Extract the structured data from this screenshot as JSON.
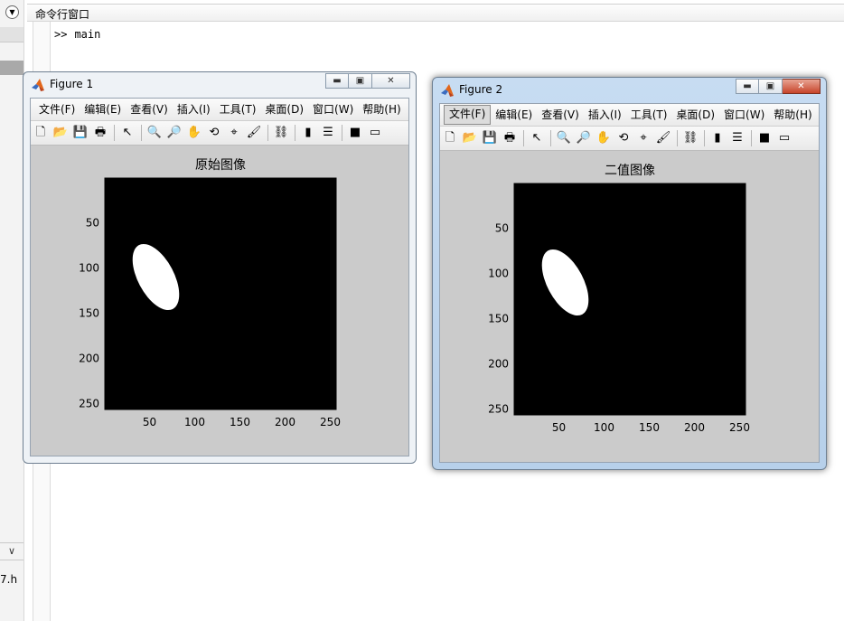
{
  "command_window": {
    "title": "命令行窗口",
    "prompt": ">>",
    "command": "main",
    "left_fragment": "7.h"
  },
  "figures": [
    {
      "title": "Figure 1",
      "menu": [
        "文件(F)",
        "编辑(E)",
        "查看(V)",
        "插入(I)",
        "工具(T)",
        "桌面(D)",
        "窗口(W)",
        "帮助(H)"
      ],
      "active_menu": -1,
      "plot_title": "原始图像",
      "ellipse": {
        "cx": 57,
        "cy": 110,
        "rx": 20,
        "ry": 40,
        "rotation_deg": -28
      }
    },
    {
      "title": "Figure 2",
      "menu": [
        "文件(F)",
        "编辑(E)",
        "查看(V)",
        "插入(I)",
        "工具(T)",
        "桌面(D)",
        "窗口(W)",
        "帮助(H)"
      ],
      "active_menu": 0,
      "plot_title": "二值图像",
      "ellipse": {
        "cx": 57,
        "cy": 110,
        "rx": 20,
        "ry": 40,
        "rotation_deg": -28
      }
    }
  ],
  "axes": {
    "x_ticks": [
      50,
      100,
      150,
      200,
      250
    ],
    "y_ticks": [
      50,
      100,
      150,
      200,
      250
    ],
    "xlim": [
      0.5,
      256.5
    ],
    "ylim": [
      0.5,
      256.5
    ],
    "image_background": "#000000",
    "object_color": "#ffffff"
  },
  "toolbar_icons": [
    "new-figure",
    "open-file",
    "save",
    "print",
    "edit-plot",
    "zoom-in",
    "zoom-out",
    "pan",
    "rotate-3d",
    "data-cursor",
    "brush",
    "link",
    "colorbar",
    "legend",
    "hide-plot-tools",
    "show-plot-tools"
  ],
  "colors": {
    "accent_blue": "#c7dcf2",
    "close_red": "#c7442a"
  }
}
